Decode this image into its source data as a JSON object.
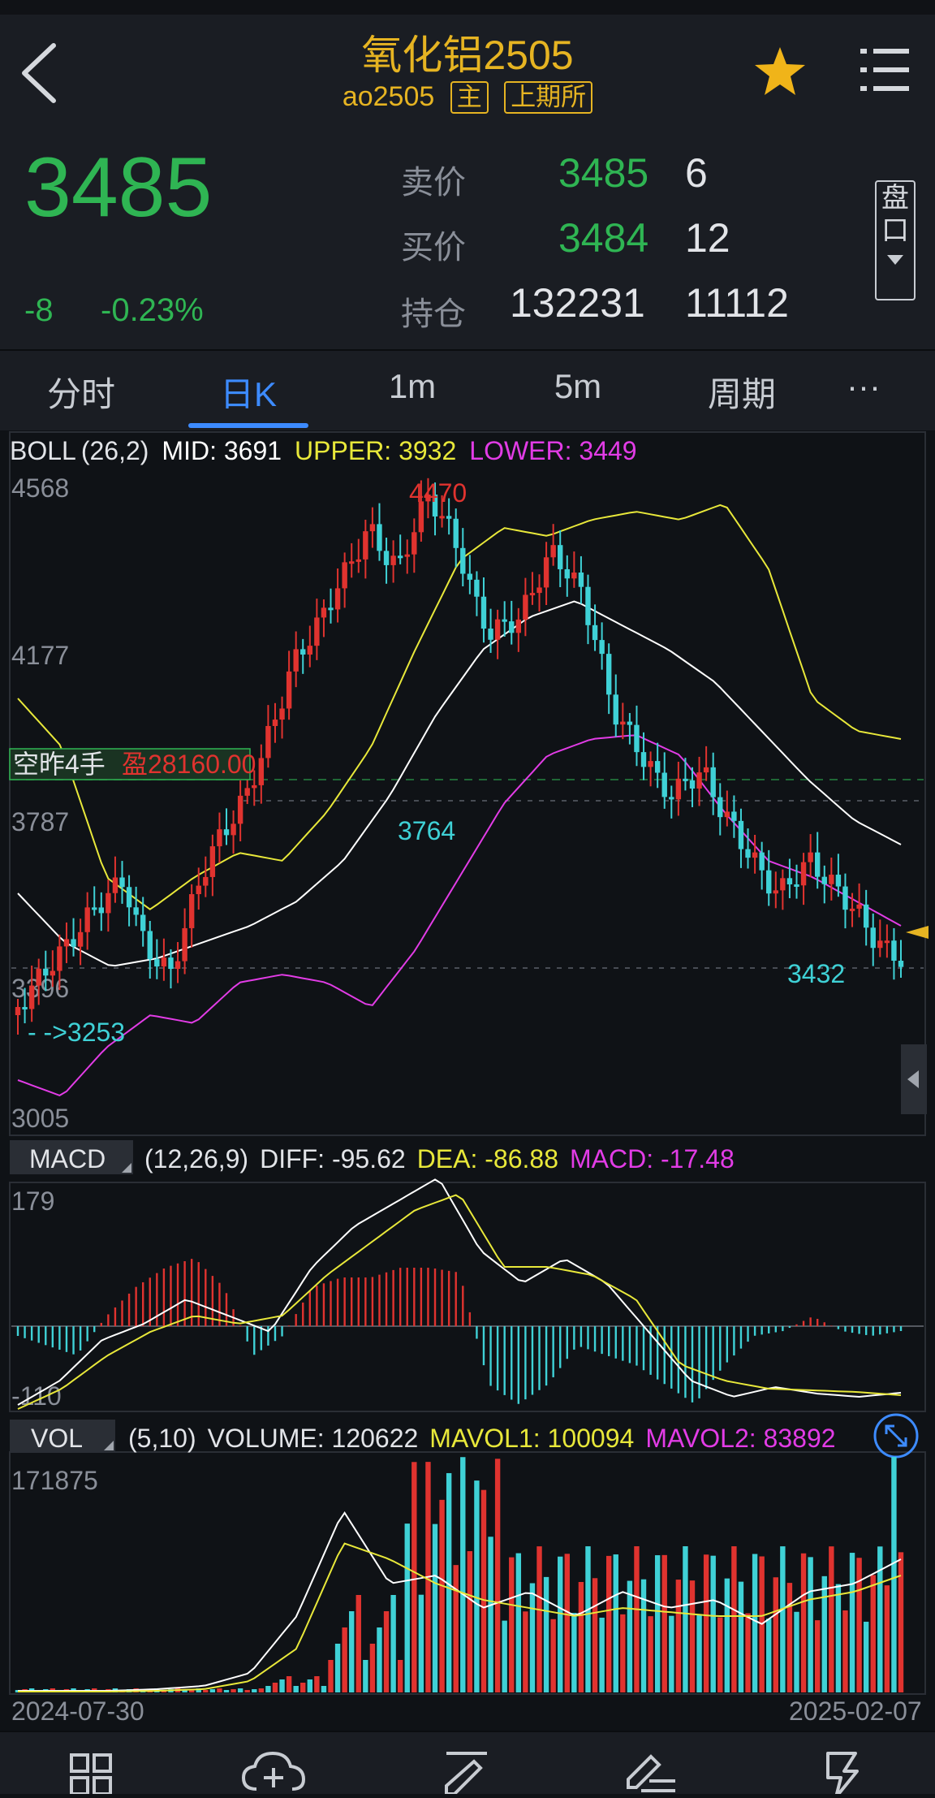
{
  "header": {
    "title": "氧化铝2505",
    "code": "ao2505",
    "tag_main": "主",
    "tag_exchange": "上期所"
  },
  "quote": {
    "last_price": "3485",
    "change": "-8",
    "change_pct": "-0.23%",
    "ask_label": "卖价",
    "ask_price": "3485",
    "ask_volume": "6",
    "bid_label": "买价",
    "bid_price": "3484",
    "bid_volume": "12",
    "oi_label": "持仓",
    "oi_value": "132231",
    "oi_change": "11112",
    "pankou_label": [
      "盘",
      "口"
    ]
  },
  "tabs": [
    {
      "label": "分时",
      "active": false
    },
    {
      "label": "日K",
      "active": true
    },
    {
      "label": "1m",
      "active": false
    },
    {
      "label": "5m",
      "active": false
    },
    {
      "label": "周期",
      "active": false
    },
    {
      "label": "···",
      "active": false
    }
  ],
  "boll": {
    "name": "BOLL",
    "params": "(26,2)",
    "mid": "MID: 3691",
    "upper": "UPPER: 3932",
    "lower": "LOWER: 3449",
    "y_ticks": [
      "4568",
      "4177",
      "3787",
      "3396",
      "3005"
    ],
    "high_label": "4470",
    "low_label": "3432",
    "mid_label": "3764",
    "start_label": "- ->3253",
    "position_label": "空昨4手",
    "position_profit": "盈28160.00"
  },
  "macd": {
    "name": "MACD",
    "params": "(12,26,9)",
    "diff": "DIFF: -95.62",
    "dea": "DEA: -86.88",
    "macd": "MACD: -17.48",
    "y_top": "179",
    "y_bottom": "-110"
  },
  "vol": {
    "name": "VOL",
    "params": "(5,10)",
    "volume": "VOLUME: 120622",
    "mavol1": "MAVOL1: 100094",
    "mavol2": "MAVOL2: 83892",
    "y_top": "171875"
  },
  "dates": {
    "start": "2024-07-30",
    "end": "2025-02-07"
  },
  "colors": {
    "up": "#e0332f",
    "down": "#3fd1d6",
    "accent": "#e6b422",
    "price_green": "#2fb553",
    "tab_active": "#3d8bff",
    "upper": "#e8e83a",
    "lower": "#e23ce6",
    "mid": "#ffffff"
  },
  "bottom_nav": {
    "icons": [
      "grid-icon",
      "cloud-add-icon",
      "pen-icon",
      "edit-list-icon",
      "lightning-icon"
    ]
  }
}
